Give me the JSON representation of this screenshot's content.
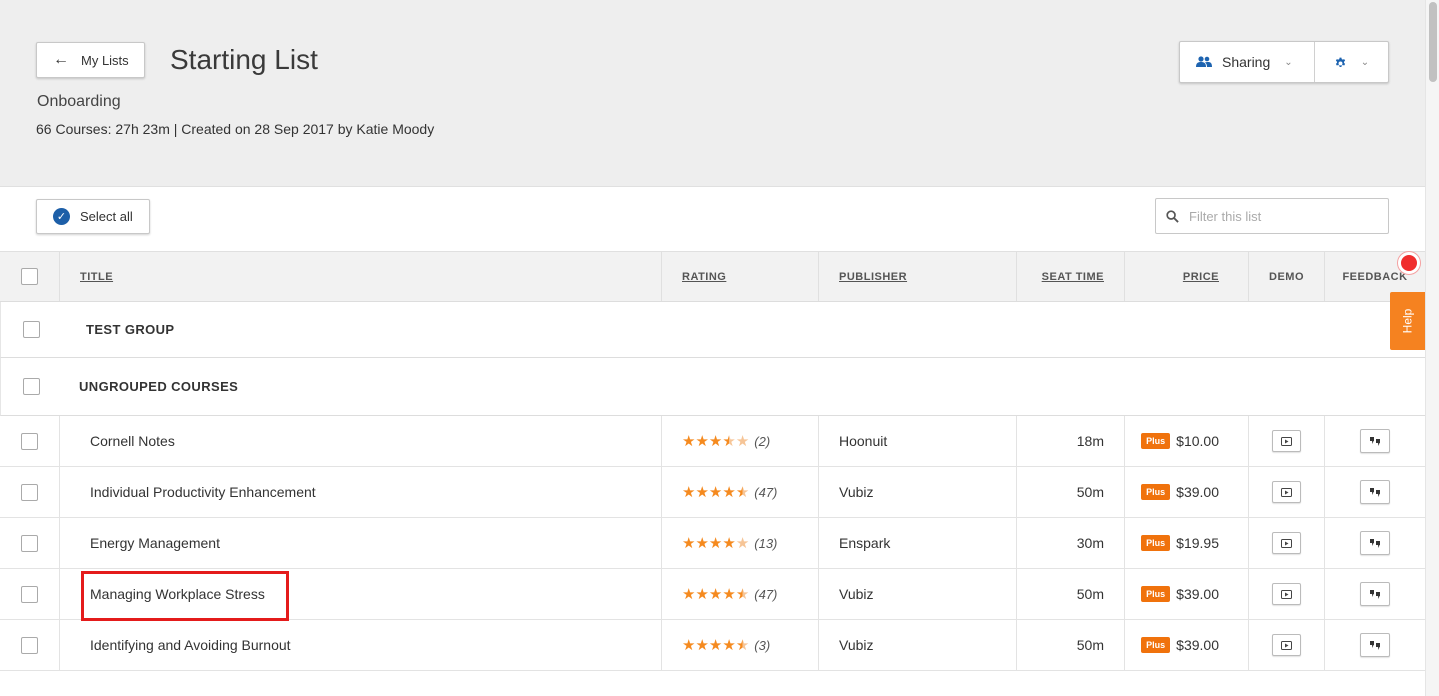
{
  "header": {
    "back_label": "My Lists",
    "title": "Starting List",
    "subtitle": "Onboarding",
    "meta": "66 Courses: 27h 23m | Created on 28 Sep 2017 by Katie Moody",
    "sharing_label": "Sharing"
  },
  "toolbar": {
    "select_all_label": "Select all",
    "filter_placeholder": "Filter this list"
  },
  "columns": {
    "title": "TITLE",
    "rating": "RATING",
    "publisher": "PUBLISHER",
    "seat_time": "SEAT TIME",
    "price": "PRICE",
    "demo": "DEMO",
    "feedback": "FEEDBACK"
  },
  "groups": {
    "test": "TEST GROUP",
    "ungrouped": "UNGROUPED COURSES"
  },
  "badge_label": "Plus",
  "help_label": "Help",
  "courses": [
    {
      "title": "Cornell Notes",
      "rating": 3.5,
      "count": "(2)",
      "publisher": "Hoonuit",
      "seat_time": "18m",
      "price": "$10.00"
    },
    {
      "title": "Individual Productivity Enhancement",
      "rating": 4.5,
      "count": "(47)",
      "publisher": "Vubiz",
      "seat_time": "50m",
      "price": "$39.00"
    },
    {
      "title": "Energy Management",
      "rating": 4,
      "count": "(13)",
      "publisher": "Enspark",
      "seat_time": "30m",
      "price": "$19.95"
    },
    {
      "title": "Managing Workplace Stress",
      "rating": 4.5,
      "count": "(47)",
      "publisher": "Vubiz",
      "seat_time": "50m",
      "price": "$39.00"
    },
    {
      "title": "Identifying and Avoiding Burnout",
      "rating": 4.5,
      "count": "(3)",
      "publisher": "Vubiz",
      "seat_time": "50m",
      "price": "$39.00"
    }
  ],
  "colors": {
    "accent": "#1d5fa8",
    "plus_badge": "#f0720c",
    "star": "#f58a1f",
    "help_tab": "#f58220",
    "highlight": "#e41b1b"
  }
}
